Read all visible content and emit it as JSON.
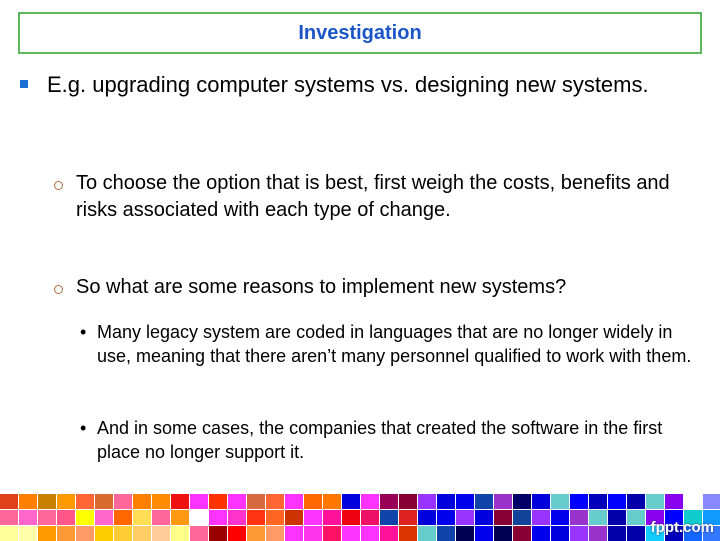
{
  "slide": {
    "title": "Investigation",
    "bullets": [
      {
        "text": "E.g. upgrading computer systems vs. designing new systems.",
        "children": [
          {
            "text": "To choose the option that is best, first weigh the costs, benefits and risks associated with each type of change."
          },
          {
            "text": "So what are some reasons to implement new systems?",
            "children": [
              {
                "text": "Many legacy system are coded in languages that are no longer widely in use, meaning that there aren’t many personnel qualified to work with them."
              },
              {
                "text": " And in some cases, the companies that created the software in the first place no longer support it."
              }
            ]
          }
        ]
      }
    ]
  },
  "footer": {
    "brand": "fppt.com",
    "mosaic_colors": [
      [
        "#e0401a",
        "#ff8000",
        "#c88000",
        "#ff9900",
        "#ff6633",
        "#d86a30",
        "#ff6699",
        "#ff8000",
        "#ff8c00",
        "#ee1111",
        "#ff33ff",
        "#ff3300",
        "#ff33ff",
        "#d86a40",
        "#ff6633",
        "#ff33ff",
        "#ff6600",
        "#ff7700",
        "#0000dd",
        "#ff33ff",
        "#990055",
        "#880033",
        "#9933ff",
        "#0000dd",
        "#0000ee",
        "#1144aa",
        "#9933cc",
        "#000066",
        "#0000dd",
        "#66cccc",
        "#0000ff",
        "#0000bb",
        "#0000ff",
        "#0000aa",
        "#66cccc",
        "#8800ee",
        "#ffffff",
        "#8888ff",
        "#9999ff",
        "#99aaee"
      ],
      [
        "#ff6699",
        "#ff66cc",
        "#ff6699",
        "#ff5588",
        "#ffff00",
        "#ff66cc",
        "#ff6600",
        "#ffdd55",
        "#ff6699",
        "#ff9911",
        "#ffffff",
        "#ff33ff",
        "#ff33cc",
        "#ff3311",
        "#ff6622",
        "#cc3300",
        "#ff33ff",
        "#ff1199",
        "#ee0011",
        "#ee1166",
        "#1144aa",
        "#dd2222",
        "#0000dd",
        "#0000ee",
        "#9933ff",
        "#0000dd",
        "#880033",
        "#114499",
        "#9933ff",
        "#0000ee",
        "#9933cc",
        "#66cccc",
        "#0000aa",
        "#66cccc",
        "#8800ee",
        "#0000ff",
        "#11cccc",
        "#1199ff",
        "#66cccc",
        "#66cccc"
      ],
      [
        "#ffff99",
        "#ffffaa",
        "#ff9900",
        "#ff9933",
        "#ff9966",
        "#ffcc00",
        "#ffcc33",
        "#ffcc66",
        "#ffcc99",
        "#ffff88",
        "#ff6699",
        "#990000",
        "#ff0000",
        "#ff9933",
        "#ff9966",
        "#ff33ff",
        "#ff33ee",
        "#ff1166",
        "#ff33ff",
        "#ff33ff",
        "#ff1199",
        "#dd3300",
        "#66cccc",
        "#1144aa",
        "#000055",
        "#0000ee",
        "#000055",
        "#880033",
        "#0000ee",
        "#0000dd",
        "#9933ff",
        "#9933cc",
        "#0000aa",
        "#0000aa",
        "#11ccff",
        "#0000bb",
        "#1166ff",
        "#3377ff",
        "#66aaff",
        "#88bbff"
      ]
    ]
  }
}
